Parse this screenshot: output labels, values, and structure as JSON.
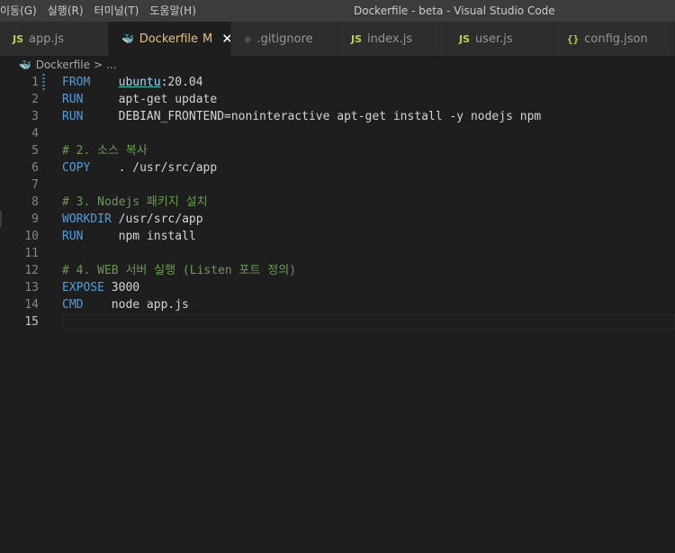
{
  "menu": {
    "items": [
      "이동(G)",
      "실행(R)",
      "터미널(T)",
      "도움말(H)"
    ]
  },
  "window": {
    "title": "Dockerfile - beta - Visual Studio Code"
  },
  "tabs": [
    {
      "label": "app.js",
      "icon": "js-icon",
      "icon_text": "JS",
      "active": false
    },
    {
      "label": "Dockerfile",
      "icon": "docker-icon",
      "icon_text": "🐳",
      "active": true,
      "modified": "M",
      "close": "✕"
    },
    {
      "label": ".gitignore",
      "icon": "git-icon",
      "icon_text": "◆",
      "active": false
    },
    {
      "label": "index.js",
      "icon": "js-icon",
      "icon_text": "JS",
      "active": false
    },
    {
      "label": "user.js",
      "icon": "js-icon",
      "icon_text": "JS",
      "active": false
    },
    {
      "label": "config.json",
      "icon": "json-icon",
      "icon_text": "{}",
      "active": false
    }
  ],
  "breadcrumb": {
    "file": "Dockerfile",
    "separator": ">",
    "more": "..."
  },
  "editor": {
    "current_line": 15,
    "lines": [
      {
        "num": "1",
        "parts": [
          {
            "t": "FROM",
            "c": "kw"
          },
          {
            "t": "    "
          },
          {
            "t": "ubuntu",
            "c": "link"
          },
          {
            "t": ":20.04"
          }
        ]
      },
      {
        "num": "2",
        "parts": [
          {
            "t": "RUN",
            "c": "kw"
          },
          {
            "t": "     apt-get update"
          }
        ]
      },
      {
        "num": "3",
        "parts": [
          {
            "t": "RUN",
            "c": "kw"
          },
          {
            "t": "     DEBIAN_FRONTEND=noninteractive apt-get install -y nodejs npm"
          }
        ]
      },
      {
        "num": "4",
        "parts": []
      },
      {
        "num": "5",
        "parts": [
          {
            "t": "# 2. 소스 복사",
            "c": "cmt"
          }
        ]
      },
      {
        "num": "6",
        "parts": [
          {
            "t": "COPY",
            "c": "kw"
          },
          {
            "t": "    . /usr/src/app"
          }
        ]
      },
      {
        "num": "7",
        "parts": []
      },
      {
        "num": "8",
        "parts": [
          {
            "t": "# 3. Nodejs 패키지 설치",
            "c": "cmt"
          }
        ]
      },
      {
        "num": "9",
        "parts": [
          {
            "t": "WORKDIR",
            "c": "kw"
          },
          {
            "t": " /usr/src/app"
          }
        ]
      },
      {
        "num": "10",
        "parts": [
          {
            "t": "RUN",
            "c": "kw"
          },
          {
            "t": "     npm install"
          }
        ]
      },
      {
        "num": "11",
        "parts": []
      },
      {
        "num": "12",
        "parts": [
          {
            "t": "# 4. WEB 서버 실행 (Listen 포트 정의)",
            "c": "cmt"
          }
        ]
      },
      {
        "num": "13",
        "parts": [
          {
            "t": "EXPOSE",
            "c": "kw"
          },
          {
            "t": " 3000"
          }
        ]
      },
      {
        "num": "14",
        "parts": [
          {
            "t": "CMD",
            "c": "kw"
          },
          {
            "t": "    node app.js"
          }
        ]
      },
      {
        "num": "15",
        "parts": []
      }
    ]
  },
  "colors": {
    "keyword": "#569cd6",
    "comment": "#6a9955",
    "text": "#d4d4d4",
    "modified_tab": "#e2c08d"
  }
}
